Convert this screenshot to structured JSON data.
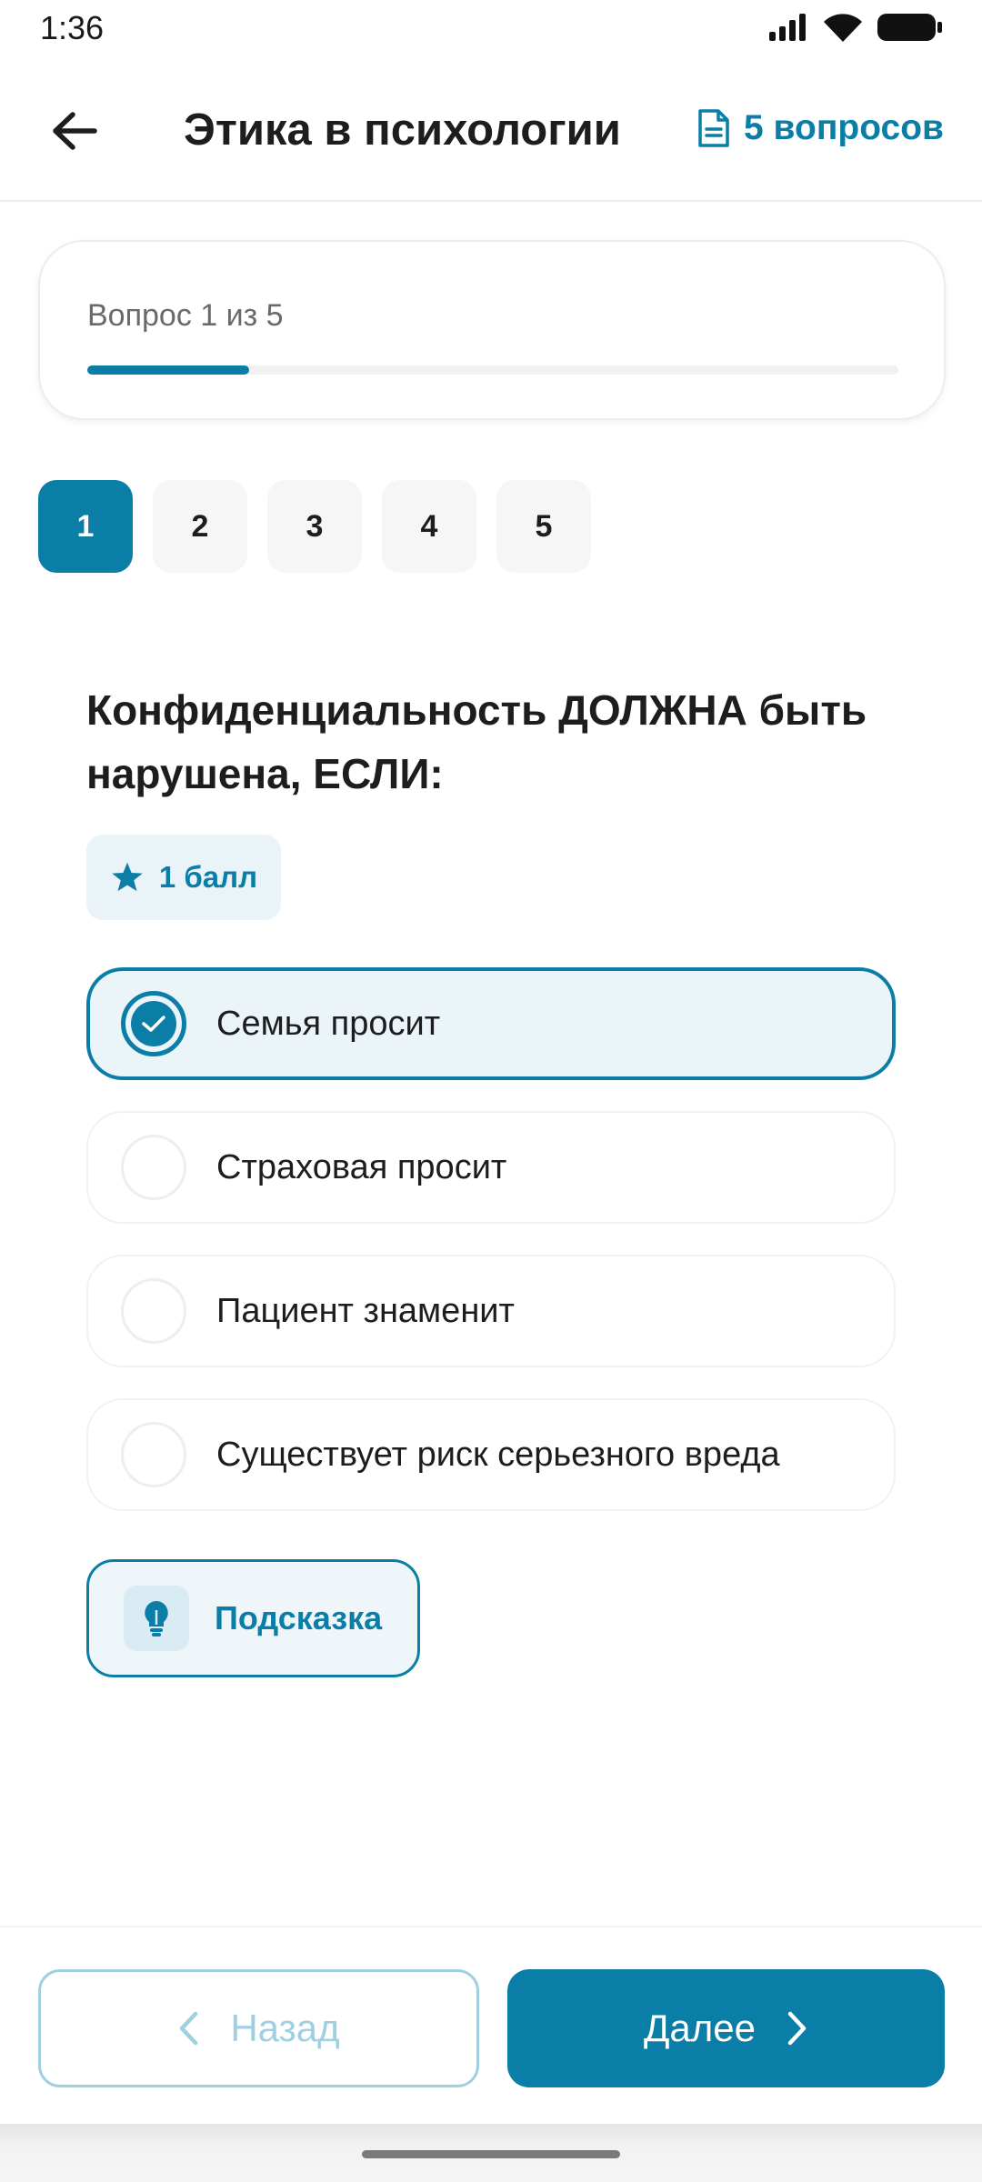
{
  "status_bar": {
    "time": "1:36",
    "icons": [
      "signal-icon",
      "wifi-icon",
      "battery-icon"
    ]
  },
  "header": {
    "title": "Этика в психологии",
    "questions_count": "5 вопросов",
    "back_icon": "arrow-left-icon",
    "count_icon": "document-icon"
  },
  "progress": {
    "label": "Вопрос 1 из 5",
    "fraction": 0.2
  },
  "question_nav": {
    "items": [
      {
        "label": "1",
        "active": true
      },
      {
        "label": "2",
        "active": false
      },
      {
        "label": "3",
        "active": false
      },
      {
        "label": "4",
        "active": false
      },
      {
        "label": "5",
        "active": false
      }
    ]
  },
  "question": {
    "text": "Конфиденциальность ДОЛЖНА быть нарушена, ЕСЛИ:",
    "points": "1 балл",
    "points_icon": "star-icon"
  },
  "answers": [
    {
      "label": "Семья просит",
      "selected": true
    },
    {
      "label": "Страховая просит",
      "selected": false
    },
    {
      "label": "Пациент знаменит",
      "selected": false
    },
    {
      "label": "Существует риск серьезного вреда",
      "selected": false
    }
  ],
  "hint": {
    "label": "Подсказка",
    "icon": "lightbulb-icon"
  },
  "footer": {
    "prev_label": "Назад",
    "next_label": "Далее"
  },
  "colors": {
    "accent": "#0b7ea7",
    "accent_light": "#eaf4f9",
    "disabled": "#9fcfe0"
  }
}
